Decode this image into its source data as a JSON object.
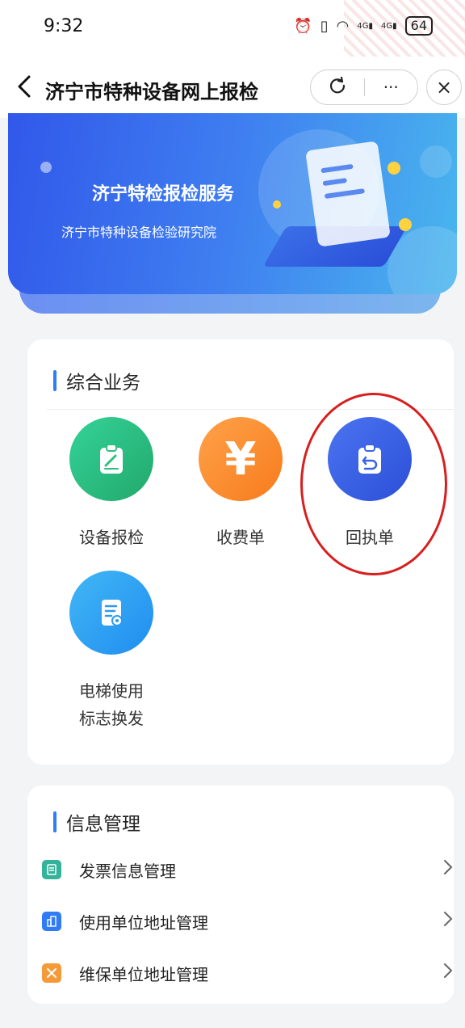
{
  "status_bar": {
    "time": "9:32",
    "icons": [
      "alarm-icon",
      "vibrate-icon",
      "wifi-icon",
      "signal-4g-icon",
      "signal-4g-icon"
    ],
    "signal_label_1": "4G",
    "signal_label_2": "4G",
    "battery": "64"
  },
  "nav": {
    "back_icon": "back-chevron-icon",
    "title": "济宁市特种设备网上报检",
    "refresh_icon": "refresh-icon",
    "more_label": "···",
    "close_label": "×"
  },
  "banner": {
    "title": "济宁特检报检服务",
    "subtitle": "济宁市特种设备检验研究院"
  },
  "business": {
    "title": "综合业务",
    "items": [
      {
        "label": "设备报检",
        "icon": "clipboard-edit-icon",
        "color_from": "#34d399",
        "color_to": "#22a86b"
      },
      {
        "label": "收费单",
        "icon": "yen-icon",
        "glyph": "¥",
        "color_from": "#ffa24a",
        "color_to": "#f77b1c"
      },
      {
        "label": "回执单",
        "icon": "clipboard-return-icon",
        "color_from": "#4b74f0",
        "color_to": "#2b4fd8"
      },
      {
        "label": "电梯使用标志换发",
        "label_line1": "电梯使用",
        "label_line2": "标志换发",
        "icon": "certificate-icon",
        "color_from": "#42b7f5",
        "color_to": "#1f8df0"
      }
    ]
  },
  "info": {
    "title": "信息管理",
    "items": [
      {
        "label": "发票信息管理",
        "icon": "invoice-icon",
        "color": "#34b39a"
      },
      {
        "label": "使用单位地址管理",
        "icon": "building-icon",
        "color": "#2f7cf6"
      },
      {
        "label": "维保单位地址管理",
        "icon": "tools-icon",
        "color": "#f59a38"
      }
    ]
  },
  "annotation": {
    "color": "#d81e1e"
  }
}
